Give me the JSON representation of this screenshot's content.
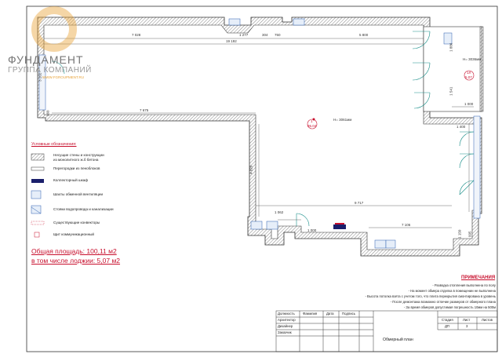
{
  "logo": {
    "name": "ФУНДАМЕНТ",
    "subtitle": "ГРУППА КОМПАНИЙ",
    "site": "WWW.FGROUPMENT.RU",
    "color": "#e8a33a"
  },
  "dims": {
    "top_left": "7 028",
    "top_1277": "1 277",
    "top_304": "304",
    "top_750": "750",
    "top_right": "5 800",
    "total": "19 192",
    "mid_7675": "7 675",
    "mid_9717": "9 717",
    "left_3202": "3 202",
    "left_960": "960",
    "left_4020": "4 020",
    "right_1886": "1 886",
    "right_1000": "1 000",
    "right_1430": "1 400",
    "right_1541": "1 541",
    "bottom_1062": "1 062",
    "bottom_1000": "1 000",
    "bottom_7106": "7 106",
    "bottom_right_1150": "1 150",
    "bottom_right_995": "995"
  },
  "rooms": {
    "main_marker": "1",
    "main_area": "95.04",
    "main_height": "H= 3061мм",
    "loggia_marker": "1Л",
    "loggia_area": "5.07",
    "loggia_height": "H= 3036мм",
    "label_hall": "H= 3067мм"
  },
  "legend": {
    "title": "Условные обозначения:",
    "items": [
      {
        "label": "Несущие стены и конструкции из монолитного ж.б бетона",
        "line2": "из монолитного ж.б бетона",
        "line1": "Несущие стены и конструкции"
      },
      {
        "label": "Перегородки из пеноблоков"
      },
      {
        "label": "Коллекторный шкаф"
      },
      {
        "label": "Шахты обменной вентиляции"
      },
      {
        "label": "Стояки водопровода и канализации"
      },
      {
        "label": "Существующие конвекторы"
      },
      {
        "label": "Щит коммуникационный"
      }
    ]
  },
  "area": {
    "total": "Общая площадь: 100,11 м2",
    "loggia": "в том числе лоджии: 5,07 м2"
  },
  "notes": {
    "title": "ПРИМЕЧАНИЯ",
    "lines": [
      "- Разводка отопления выполнена по полу",
      "- На момент обмера отделка в помещении не выполнена",
      "- Высота потолка взята с учетом того, что плита перекрытия смонтирована в уровень",
      "- После демонтажа возможно отличие размеров от обмерного плана",
      "- За время обмеров допустимая погрешность 10мм на 500м"
    ]
  },
  "titleblock": {
    "rows": [
      "Должность",
      "Архитектор",
      "Дизайнер",
      "Заказчик"
    ],
    "cols": [
      "Фамилия",
      "Дата",
      "Подпись"
    ],
    "stage_h": "Стадия",
    "sheet_h": "Лист",
    "sheets_h": "Листов",
    "stage": "ДП",
    "sheet": "3",
    "sheets": "",
    "drawing": "Обмерный план"
  },
  "colors": {
    "wall_hatch": "#555555",
    "red": "#c8102e",
    "blue": "#2a5fb0",
    "door": "#1a8f8a",
    "line": "#222222"
  }
}
